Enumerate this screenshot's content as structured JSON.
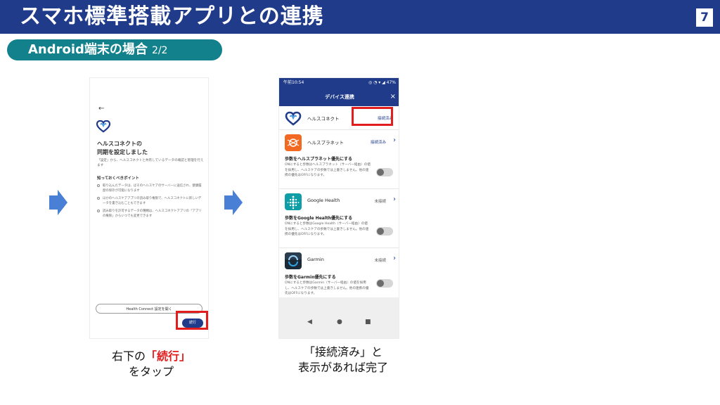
{
  "slide": {
    "title": "スマホ標準搭載アプリとの連携",
    "page_number": "7",
    "section_label": "Android端末の場合",
    "section_sub": "2/2"
  },
  "phone1": {
    "back": "←",
    "title": "ヘルスコネクトの\n同期を設定しました",
    "description": "「設定」から、ヘルスコネクトと共有しているデータの確認と管理を行えます",
    "points_heading": "知っておくべきポイント",
    "points": [
      "取り込んだデータは、ばそのヘルスケアのサーバーに送信され、健康履歴の保存が可能になります",
      "ほかのヘルスケアアプリの読み取り権限で、ヘルスコネクトに新しいデータを書き込むこともできます",
      "読み取りを許可するデータの種類は、ヘルスコネクトアプリの「アプリの権限」からいつでも変更できます"
    ],
    "health_connect_button": "Health Connect 設定を開く",
    "continue_button": "続行"
  },
  "phone2": {
    "status_time": "午前10:54",
    "status_icons": "◎ ◔ ▾ ◢ 47%",
    "title": "デバイス連携",
    "close": "×",
    "apps": [
      {
        "name": "ヘルスコネクト",
        "status": "接続済み"
      },
      {
        "name": "ヘルスプラネット",
        "status": "接続済み",
        "pref_title": "歩数をヘルスプラネット優先にする",
        "pref_desc": "ONにすると歩数はヘルスプラネット（サーバー経由）の値を採用し、ヘルスケアの歩数では上書きしません。他の連携の優先はOFFになります。"
      },
      {
        "name": "Google Health",
        "status": "未接続",
        "pref_title": "歩数をGoogle Health優先にする",
        "pref_desc": "ONにすると歩数はGoogle Health（サーバー経由）の値を採用し、ヘルスケアの歩数では上書きしません。他の連携の優先はOFFになります。"
      },
      {
        "name": "Garmin",
        "status": "未接続",
        "pref_title": "歩数をGarmin優先にする",
        "pref_desc": "ONにすると歩数はGarmin（サーバー経由）の値を採用し、ヘルスケアの歩数では上書きしません。他の連携の優先はOFFになります。"
      }
    ],
    "nav": {
      "back": "◀",
      "home": "●",
      "recents": "■"
    }
  },
  "captions": {
    "step1_prefix": "右下の",
    "step1_highlight": "「続行」",
    "step1_suffix": "をタップ",
    "step2_line1": "「接続済み」と",
    "step2_line2": "表示があれば完了"
  },
  "colors": {
    "header": "#1f3b8a",
    "section": "#12818c",
    "arrow": "#4a7fd6",
    "highlight": "#e11d1d"
  }
}
